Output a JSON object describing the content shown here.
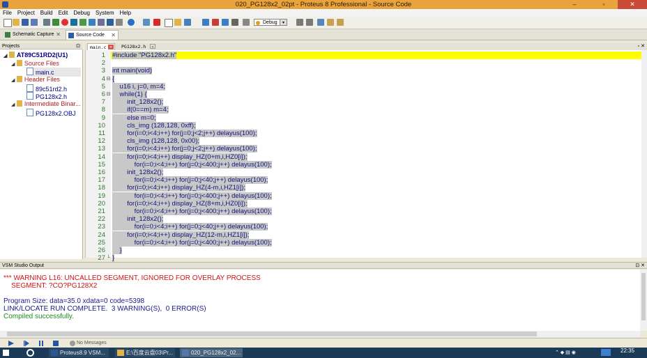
{
  "window": {
    "title": "020_PG128x2_02pt - Proteus 8 Professional - Source Code",
    "minimize": "–",
    "maximize": "▫",
    "close": "✕"
  },
  "menu": [
    "File",
    "Project",
    "Build",
    "Edit",
    "Debug",
    "System",
    "Help"
  ],
  "toolbar": {
    "debug_mode": "Debug"
  },
  "app_tabs": [
    {
      "label": "Schematic Capture",
      "close": "✕"
    },
    {
      "label": "Source Code",
      "close": "✕"
    }
  ],
  "file_tabs": [
    {
      "label": "main.c",
      "close": "✕"
    },
    {
      "label": "PG128x2.h",
      "close": "✕"
    }
  ],
  "projects": {
    "header": "Projects",
    "root": "AT89C51RD2(U1)",
    "groups": [
      {
        "label": "Source Files",
        "files": [
          "main.c"
        ]
      },
      {
        "label": "Header Files",
        "files": [
          "89c51rd2.h",
          "PG128x2.h"
        ]
      },
      {
        "label": "Intermediate Binar...",
        "files": [
          "PG128x2.OBJ"
        ]
      }
    ]
  },
  "editor": {
    "lines": [
      "#include \"PG128x2.h\"",
      "",
      "int main(void)",
      "{",
      "    u16 i, j=0, m=4;",
      "    while(1) {",
      "        init_128x2();",
      "        if(0==m) m=4;",
      "        else m=0;",
      "        cls_img (128,128, 0xff);",
      "        for(i=0;i<4;i++) for(j=0;j<2;j++) delayus(100);",
      "        cls_img (128,128, 0x00);",
      "        for(i=0;i<4;i++) for(j=0;j<2;j++) delayus(100);",
      "        for(i=0;i<4;i++) display_HZ(0+m,i,HZ0[i]);",
      "            for(i=0;i<4;i++) for(j=0;j<400;j++) delayus(100);",
      "        init_128x2();",
      "            for(i=0;i<4;i++) for(j=0;j<40;j++) delayus(100);",
      "        for(i=0;i<4;i++) display_HZ(4-m,i,HZ1[i]);",
      "            for(i=0;i<4;i++) for(j=0;j<400;j++) delayus(100);",
      "        for(i=0;i<4;i++) display_HZ(8+m,i,HZ0[i]);",
      "            for(i=0;i<4;i++) for(j=0;j<400;j++) delayus(100);",
      "        init_128x2();",
      "            for(i=0;i<4;i++) for(j=0;j<40;j++) delayus(100);",
      "        for(i=0;i<4;i++) display_HZ(12-m,i,HZ1[i]);",
      "            for(i=0;i<4;i++) for(j=0;j<400;j++) delayus(100);",
      "    }",
      "}"
    ],
    "line_numbers": [
      "1",
      "2",
      "3",
      "4",
      "5",
      "6",
      "7",
      "8",
      "9",
      "10",
      "11",
      "12",
      "13",
      "14",
      "15",
      "16",
      "17",
      "18",
      "19",
      "20",
      "21",
      "22",
      "23",
      "24",
      "25",
      "26",
      "27"
    ]
  },
  "output": {
    "header": "VSM Studio Output",
    "lines": [
      {
        "text": "*** WARNING L16: UNCALLED SEGMENT, IGNORED FOR OVERLAY PROCESS",
        "color": "#d11414"
      },
      {
        "text": "    SEGMENT: ?CO?PG128X2",
        "color": "#d11414"
      },
      {
        "text": "",
        "color": "#000000"
      },
      {
        "text": "Program Size: data=35.0 xdata=0 code=5398",
        "color": "#1a1a8c"
      },
      {
        "text": "LINK/LOCATE RUN COMPLETE.  3 WARNING(S),  0 ERROR(S)",
        "color": "#1a1a8c"
      },
      {
        "text": "Compiled successfully.",
        "color": "#1f8a1f"
      }
    ]
  },
  "status": {
    "messages": "No Messages"
  },
  "taskbar": {
    "items": [
      "Proteus8.9 VSM...",
      "E:\\百度云盘03\\Pr...",
      "020_PG128x2_02..."
    ],
    "clock": "22:35"
  },
  "colors": {
    "titlebar": "#e8a33c",
    "line_highlight": "#fffe00",
    "warning": "#d11414",
    "success": "#1f8a1f"
  }
}
